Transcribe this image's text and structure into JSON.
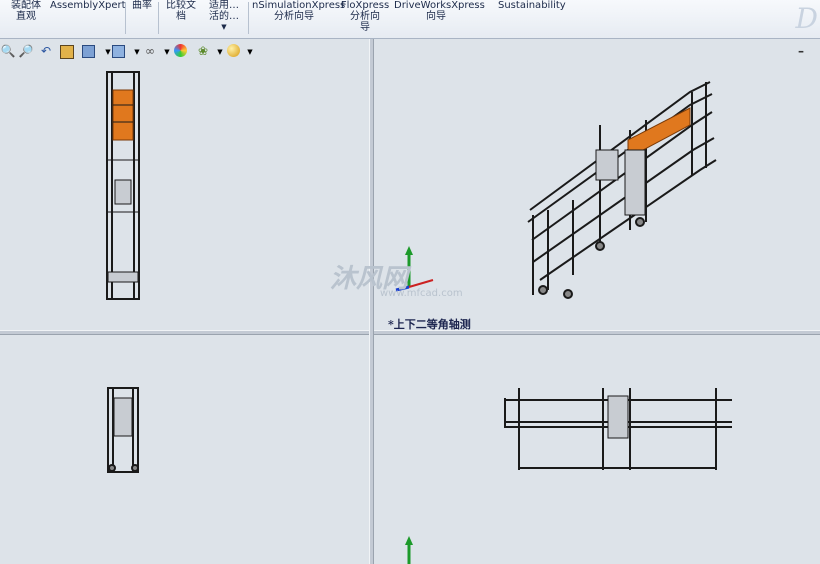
{
  "ribbon": {
    "items": [
      {
        "label": "装配体\n直观"
      },
      {
        "label": "AssemblyXpert"
      },
      {
        "label": "曲率"
      },
      {
        "label": "比较文\n档"
      },
      {
        "label": "适用…\n活的…"
      },
      {
        "label": "nSimulationXpress\n分析向导"
      },
      {
        "label": "FloXpress\n分析向\n导"
      },
      {
        "label": "DriveWorksXpress\n向导"
      },
      {
        "label": "Sustainability"
      }
    ],
    "logo": "D"
  },
  "toolbar": {
    "icons": [
      "zoom-fit-icon",
      "zoom-area-icon",
      "previous-view-icon",
      "section-view-icon",
      "view-orientation-icon",
      "display-style-icon",
      "hide-show-icon",
      "edit-appearance-icon",
      "apply-scene-icon",
      "view-settings-icon"
    ]
  },
  "viewport": {
    "top_right_label": "*上下二等角轴测",
    "minimize_glyph": "–"
  },
  "watermark": {
    "main": "沐风网",
    "url": "www.mfcad.com"
  },
  "colors": {
    "frame": "#1a1a1a",
    "accent_orange": "#e0781e",
    "axis_green": "#1c9a2a",
    "axis_red": "#cc2222",
    "axis_blue": "#1a3fcf"
  }
}
